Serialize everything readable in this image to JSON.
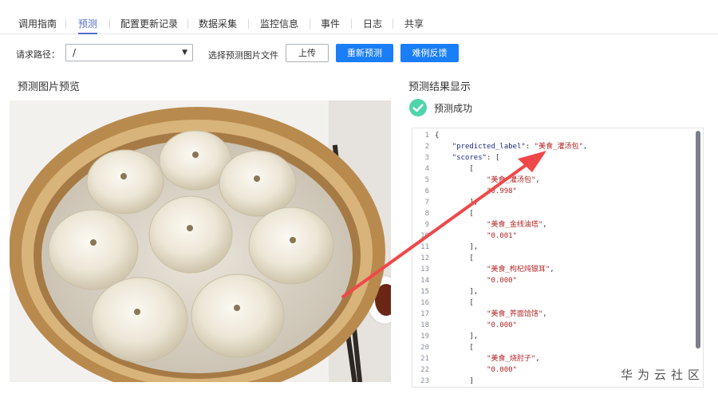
{
  "tabs": [
    "调用指南",
    "预测",
    "配置更新记录",
    "数据采集",
    "监控信息",
    "事件",
    "日志",
    "共享"
  ],
  "active_tab": "预测",
  "toolbar": {
    "path_label": "请求路径：",
    "path_value": "/",
    "file_label": "选择预测图片文件",
    "upload_button": "上传",
    "repredict_button": "重新预测",
    "feedback_button": "难例反馈"
  },
  "preview": {
    "title": "预测图片预览"
  },
  "result": {
    "title": "预测结果显示",
    "status": "预测成功",
    "code_lines": [
      {
        "n": "1",
        "tokens": [
          {
            "t": "{",
            "c": "p"
          }
        ]
      },
      {
        "n": "2",
        "tokens": [
          {
            "t": "    ",
            "c": "p"
          },
          {
            "t": "\"predicted_label\"",
            "c": "k"
          },
          {
            "t": ": ",
            "c": "p"
          },
          {
            "t": "\"美食_灌汤包\"",
            "c": "s"
          },
          {
            "t": ",",
            "c": "p"
          }
        ]
      },
      {
        "n": "3",
        "tokens": [
          {
            "t": "    ",
            "c": "p"
          },
          {
            "t": "\"scores\"",
            "c": "k"
          },
          {
            "t": ": [",
            "c": "p"
          }
        ]
      },
      {
        "n": "4",
        "tokens": [
          {
            "t": "        [",
            "c": "p"
          }
        ]
      },
      {
        "n": "5",
        "tokens": [
          {
            "t": "            ",
            "c": "p"
          },
          {
            "t": "\"美食_灌汤包\"",
            "c": "s"
          },
          {
            "t": ",",
            "c": "p"
          }
        ]
      },
      {
        "n": "6",
        "tokens": [
          {
            "t": "            ",
            "c": "p"
          },
          {
            "t": "\"0.998\"",
            "c": "s"
          }
        ]
      },
      {
        "n": "7",
        "tokens": [
          {
            "t": "        ],",
            "c": "p"
          }
        ]
      },
      {
        "n": "8",
        "tokens": [
          {
            "t": "        [",
            "c": "p"
          }
        ]
      },
      {
        "n": "9",
        "tokens": [
          {
            "t": "            ",
            "c": "p"
          },
          {
            "t": "\"美食_金线油塔\"",
            "c": "s"
          },
          {
            "t": ",",
            "c": "p"
          }
        ]
      },
      {
        "n": "10",
        "tokens": [
          {
            "t": "            ",
            "c": "p"
          },
          {
            "t": "\"0.001\"",
            "c": "s"
          }
        ]
      },
      {
        "n": "11",
        "tokens": [
          {
            "t": "        ],",
            "c": "p"
          }
        ]
      },
      {
        "n": "12",
        "tokens": [
          {
            "t": "        [",
            "c": "p"
          }
        ]
      },
      {
        "n": "13",
        "tokens": [
          {
            "t": "            ",
            "c": "p"
          },
          {
            "t": "\"美食_枸杞炖银耳\"",
            "c": "s"
          },
          {
            "t": ",",
            "c": "p"
          }
        ]
      },
      {
        "n": "14",
        "tokens": [
          {
            "t": "            ",
            "c": "p"
          },
          {
            "t": "\"0.000\"",
            "c": "s"
          }
        ]
      },
      {
        "n": "15",
        "tokens": [
          {
            "t": "        ],",
            "c": "p"
          }
        ]
      },
      {
        "n": "16",
        "tokens": [
          {
            "t": "        [",
            "c": "p"
          }
        ]
      },
      {
        "n": "17",
        "tokens": [
          {
            "t": "            ",
            "c": "p"
          },
          {
            "t": "\"美食_荞面饸饹\"",
            "c": "s"
          },
          {
            "t": ",",
            "c": "p"
          }
        ]
      },
      {
        "n": "18",
        "tokens": [
          {
            "t": "            ",
            "c": "p"
          },
          {
            "t": "\"0.000\"",
            "c": "s"
          }
        ]
      },
      {
        "n": "19",
        "tokens": [
          {
            "t": "        ],",
            "c": "p"
          }
        ]
      },
      {
        "n": "20",
        "tokens": [
          {
            "t": "        [",
            "c": "p"
          }
        ]
      },
      {
        "n": "21",
        "tokens": [
          {
            "t": "            ",
            "c": "p"
          },
          {
            "t": "\"美食_烧肘子\"",
            "c": "s"
          },
          {
            "t": ",",
            "c": "p"
          }
        ]
      },
      {
        "n": "22",
        "tokens": [
          {
            "t": "            ",
            "c": "p"
          },
          {
            "t": "\"0.000\"",
            "c": "s"
          }
        ]
      },
      {
        "n": "23",
        "tokens": [
          {
            "t": "        ]",
            "c": "p"
          }
        ]
      }
    ]
  },
  "watermark": "华为云社区",
  "colors": {
    "active_tab": "#526ecc",
    "primary_button": "#1a7ef7",
    "success_icon": "#50d4ab",
    "json_key": "#1d2c84",
    "json_string": "#b32424",
    "annotation_arrow": "#f04848"
  },
  "icons": {
    "select_caret": "caret-down-icon",
    "status": "check-circle-icon"
  }
}
